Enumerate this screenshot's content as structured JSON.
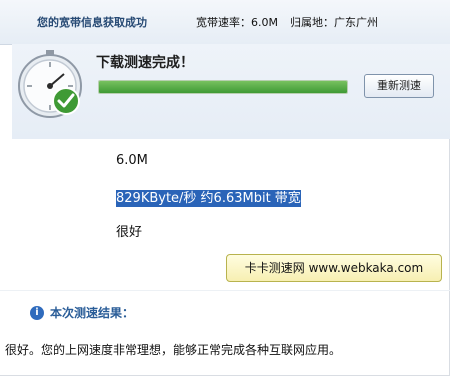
{
  "header": {
    "status_title": "您的宽带信息获取成功",
    "bandwidth_label": "宽带速率：",
    "bandwidth_value": "6.0M",
    "location_label": "归属地：",
    "location_value": "广东广州"
  },
  "test": {
    "complete_title": "下载测速完成！",
    "progress_percent": 100,
    "retest_label": "重新测速"
  },
  "results": {
    "bandwidth": "6.0M",
    "speed_line": "829KByte/秒 约6.63Mbit 带宽",
    "rating": "很好"
  },
  "brand": {
    "text": "卡卡测速网 www.webkaka.com"
  },
  "summary": {
    "heading": "本次测速结果：",
    "text": "很好。您的上网速度非常理想，能够正常完成各种互联网应用。"
  },
  "colors": {
    "accent": "#2a64b8",
    "progress": "#3f9a35",
    "badge": "#f7efb2"
  }
}
